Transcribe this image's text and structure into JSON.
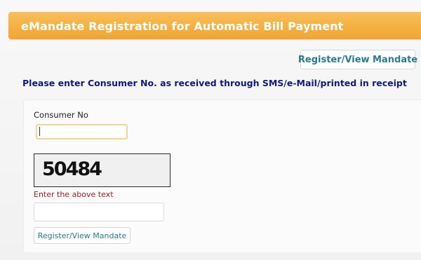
{
  "header": {
    "title": "eMandate Registration for Automatic Bill Payment"
  },
  "top_button": {
    "label": "Register/View Mandate"
  },
  "instruction": "Please enter Consumer No. as received through SMS/e-Mail/printed in receipt",
  "form": {
    "consumer_label": "Consumer No",
    "consumer_value": "",
    "captcha_code": "50484",
    "captcha_label": "Enter the above text",
    "captcha_value": "",
    "submit_label": "Register/View Mandate"
  },
  "colors": {
    "header_orange": "#f0a532",
    "link_teal": "#2a7a94",
    "instruction_navy": "#101a7a",
    "error_red": "#a21e1e"
  }
}
